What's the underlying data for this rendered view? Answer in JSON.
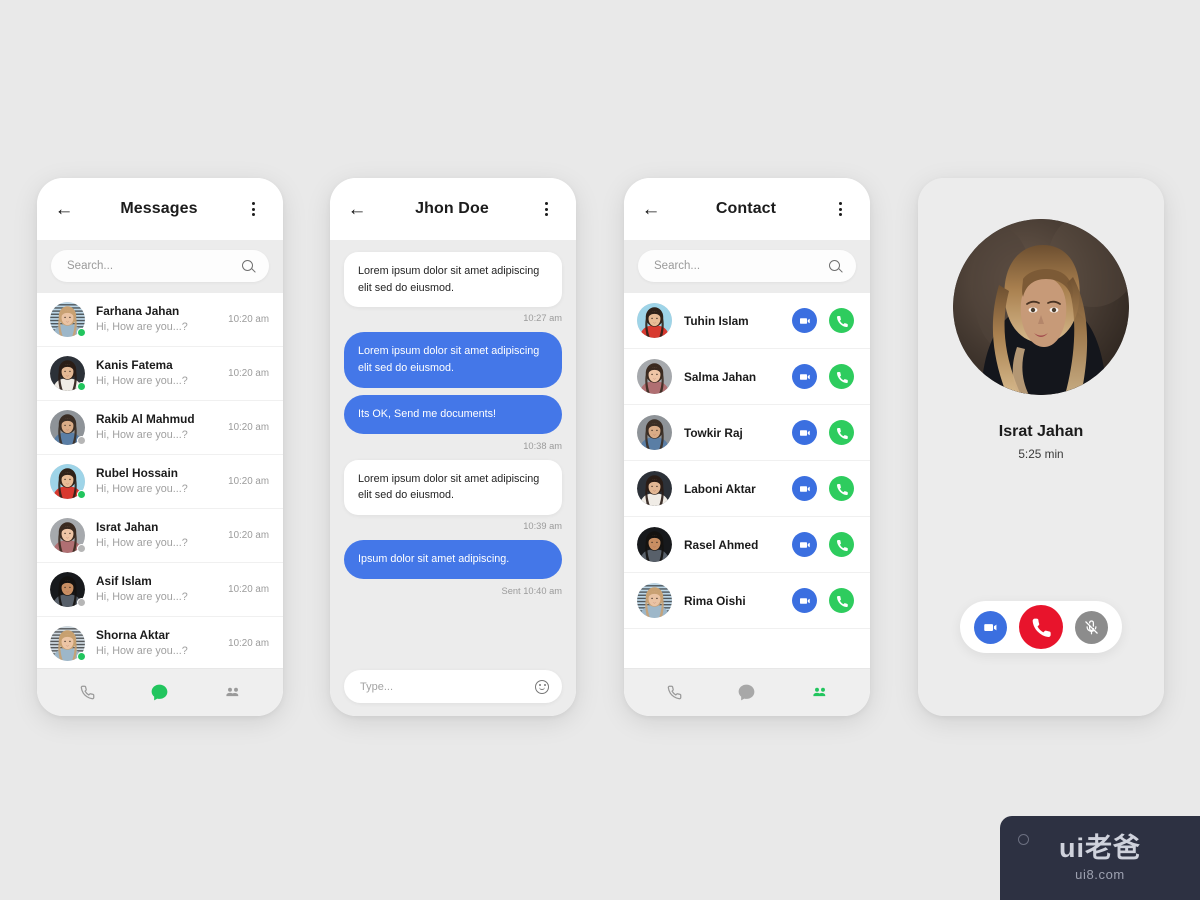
{
  "canvas": {
    "background": "#e9e9e9"
  },
  "theme": {
    "accent_blue": "#4477e8",
    "accent_green": "#2ecc5e",
    "accent_red": "#e8142c",
    "accent_gray": "#8c8c8c",
    "button_blue": "#3b6fe0",
    "screen_bg": "#ececec",
    "card_bg": "#ffffff"
  },
  "screens": [
    {
      "id": "messages",
      "header": {
        "back_icon": "arrow-left-icon",
        "title": "Messages",
        "menu_icon": "more-vertical-icon"
      },
      "search": {
        "placeholder": "Search...",
        "icon": "search-icon"
      },
      "items": [
        {
          "name": "Farhana Jahan",
          "preview": "Hi, How are you...?",
          "time": "10:20 am",
          "status": "online"
        },
        {
          "name": "Kanis Fatema",
          "preview": "Hi, How are you...?",
          "time": "10:20 am",
          "status": "online"
        },
        {
          "name": "Rakib Al Mahmud",
          "preview": "Hi, How are you...?",
          "time": "10:20 am",
          "status": "offline"
        },
        {
          "name": "Rubel Hossain",
          "preview": "Hi, How are you...?",
          "time": "10:20 am",
          "status": "online"
        },
        {
          "name": "Israt Jahan",
          "preview": "Hi, How are you...?",
          "time": "10:20 am",
          "status": "offline"
        },
        {
          "name": "Asif Islam",
          "preview": "Hi, How are you...?",
          "time": "10:20 am",
          "status": "offline"
        },
        {
          "name": "Shorna Aktar",
          "preview": "Hi, How are you...?",
          "time": "10:20 am",
          "status": "online"
        }
      ],
      "nav": {
        "active": "chat",
        "items": [
          "phone-icon",
          "chat-icon",
          "contacts-icon"
        ]
      }
    },
    {
      "id": "chat",
      "header": {
        "back_icon": "arrow-left-icon",
        "title": "Jhon Doe",
        "menu_icon": "more-vertical-icon"
      },
      "messages": [
        {
          "side": "in",
          "text": "Lorem ipsum dolor sit amet adipiscing elit sed do eiusmod.",
          "time": "10:27 am"
        },
        {
          "side": "out",
          "text": "Lorem ipsum dolor sit amet adipiscing elit sed do eiusmod.",
          "time": ""
        },
        {
          "side": "out",
          "text": "Its OK, Send me documents!",
          "time": "10:38 am"
        },
        {
          "side": "in",
          "text": "Lorem ipsum dolor sit amet adipiscing elit sed do eiusmod.",
          "time": "10:39 am"
        },
        {
          "side": "out",
          "text": "Ipsum dolor sit amet adipiscing.",
          "time": "Sent  10:40 am"
        }
      ],
      "input": {
        "placeholder": "Type...",
        "emoji_icon": "smiley-icon"
      }
    },
    {
      "id": "contact",
      "header": {
        "back_icon": "arrow-left-icon",
        "title": "Contact",
        "menu_icon": "more-vertical-icon"
      },
      "search": {
        "placeholder": "Search...",
        "icon": "search-icon"
      },
      "contacts": [
        {
          "name": "Tuhin Islam"
        },
        {
          "name": "Salma Jahan"
        },
        {
          "name": "Towkir Raj"
        },
        {
          "name": "Laboni Aktar"
        },
        {
          "name": "Rasel Ahmed"
        },
        {
          "name": "Rima Oishi"
        }
      ],
      "row_actions": {
        "video_icon": "video-camera-icon",
        "call_icon": "phone-icon"
      },
      "nav": {
        "active": "contacts",
        "items": [
          "phone-icon",
          "chat-icon",
          "contacts-icon"
        ]
      }
    },
    {
      "id": "call",
      "name": "Israt Jahan",
      "duration": "5:25 min",
      "actions": [
        {
          "id": "video",
          "icon": "video-camera-icon",
          "color": "#3b6fe0"
        },
        {
          "id": "endcall",
          "icon": "phone-icon",
          "color": "#e8142c"
        },
        {
          "id": "mute",
          "icon": "mic-off-icon",
          "color": "#8c8c8c"
        }
      ]
    }
  ],
  "watermark": {
    "main": "ui老爸",
    "sub": "ui8.com"
  }
}
